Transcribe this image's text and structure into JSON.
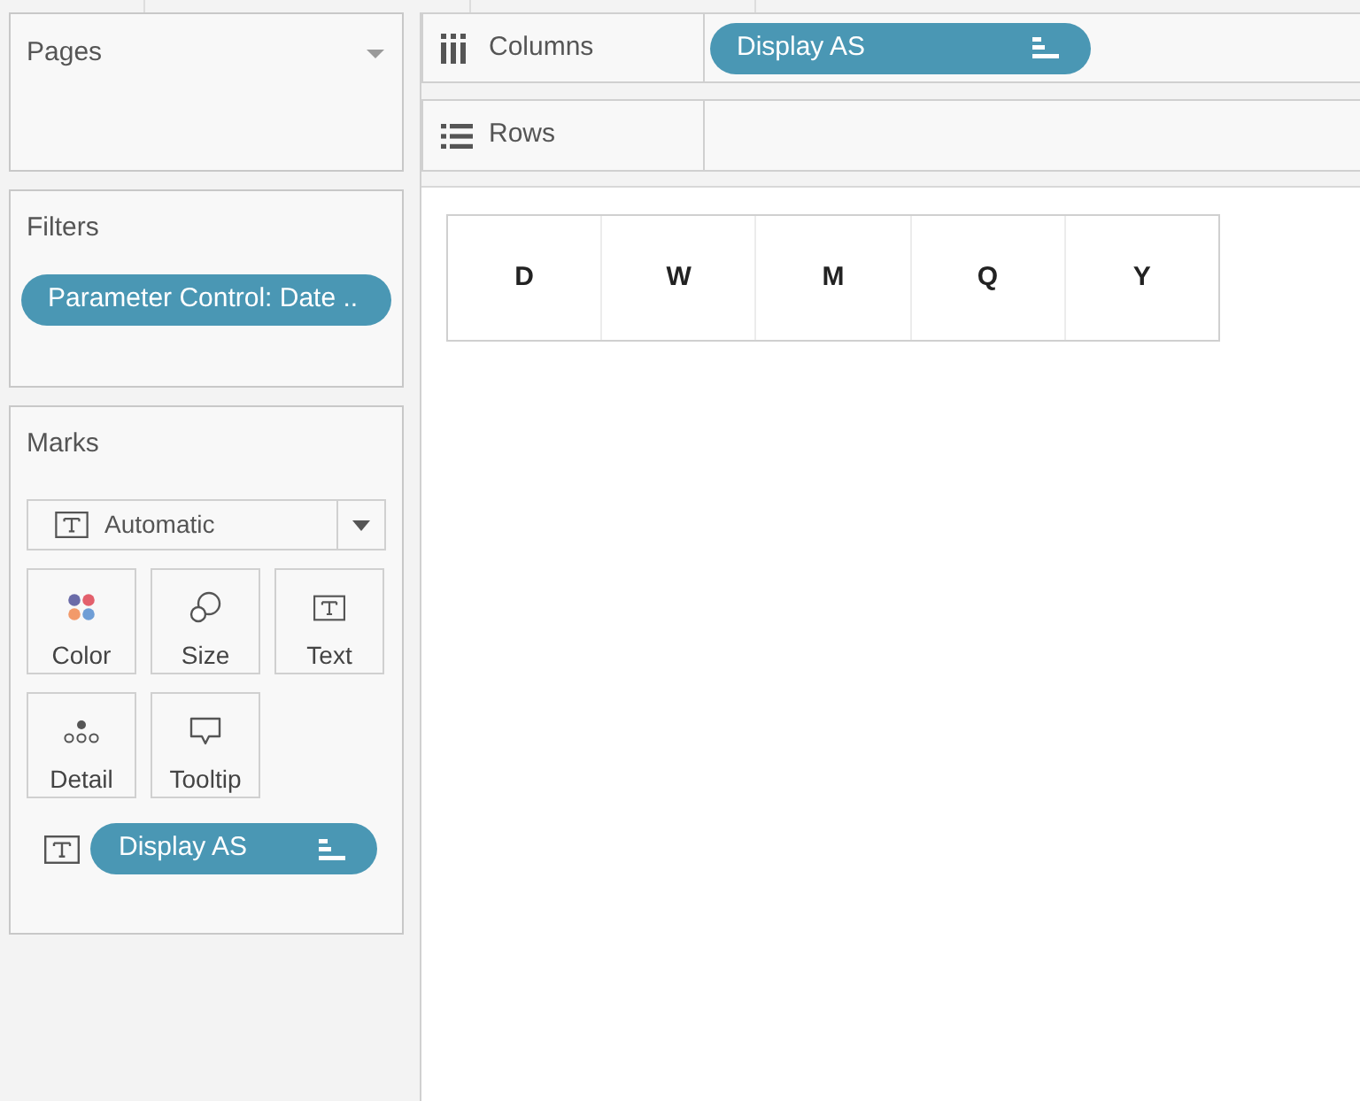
{
  "pages": {
    "title": "Pages"
  },
  "filters": {
    "title": "Filters",
    "pills": [
      {
        "label": "Parameter Control: Date .."
      }
    ]
  },
  "marks": {
    "title": "Marks",
    "mark_type": "Automatic",
    "cards": [
      {
        "label": "Color",
        "kind": "color"
      },
      {
        "label": "Size",
        "kind": "size"
      },
      {
        "label": "Text",
        "kind": "text"
      },
      {
        "label": "Detail",
        "kind": "detail"
      },
      {
        "label": "Tooltip",
        "kind": "tooltip"
      }
    ],
    "fields": [
      {
        "label": "Display AS",
        "kind": "text"
      }
    ]
  },
  "shelves": [
    {
      "label": "Columns",
      "kind": "columns",
      "pills": [
        {
          "label": "Display AS"
        }
      ]
    },
    {
      "label": "Rows",
      "kind": "rows"
    }
  ],
  "table": {
    "cells": [
      "D",
      "W",
      "M",
      "Q",
      "Y"
    ]
  }
}
